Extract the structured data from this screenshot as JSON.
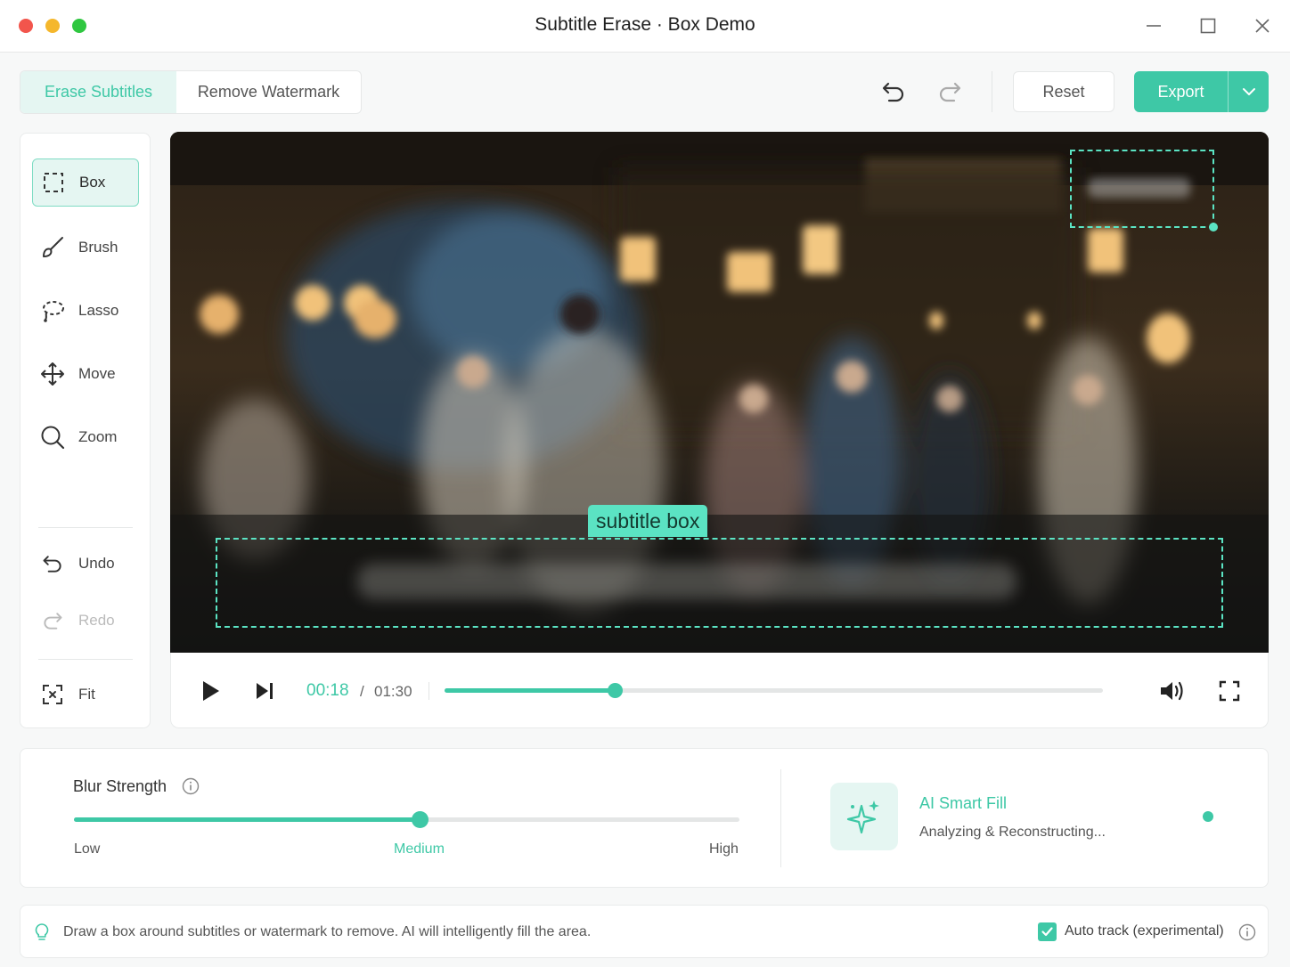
{
  "window": {
    "title": "Subtitle Erase · Box Demo"
  },
  "mode_tabs": [
    {
      "label": "Erase Subtitles",
      "active": true
    },
    {
      "label": "Remove Watermark",
      "active": false
    }
  ],
  "toolbar": {
    "reset_label": "Reset",
    "export_label": "Export"
  },
  "tools": {
    "box": "Box",
    "brush": "Brush",
    "lasso": "Lasso",
    "move": "Move",
    "zoom": "Zoom",
    "undo": "Undo",
    "redo": "Redo",
    "fit": "Fit"
  },
  "video": {
    "subtitle_tag": "subtitle box"
  },
  "player": {
    "current_time": "00:18",
    "separator": "/",
    "total_time": "01:30",
    "progress": 0.258
  },
  "blur": {
    "label": "Blur Strength",
    "level": 0.52,
    "low_label": "Low",
    "medium_label": "Medium",
    "high_label": "High"
  },
  "ai_fill": {
    "title": "AI Smart Fill",
    "status": "Analyzing & Reconstructing..."
  },
  "hint": {
    "text": "Draw a box around subtitles or watermark to remove. AI will intelligently fill the area.",
    "auto_track_label": "Auto track (experimental)",
    "auto_track_checked": true
  },
  "colors": {
    "accent": "#3ec8a6",
    "selection": "#5be3c3",
    "accent_soft": "#e5f6f2"
  }
}
